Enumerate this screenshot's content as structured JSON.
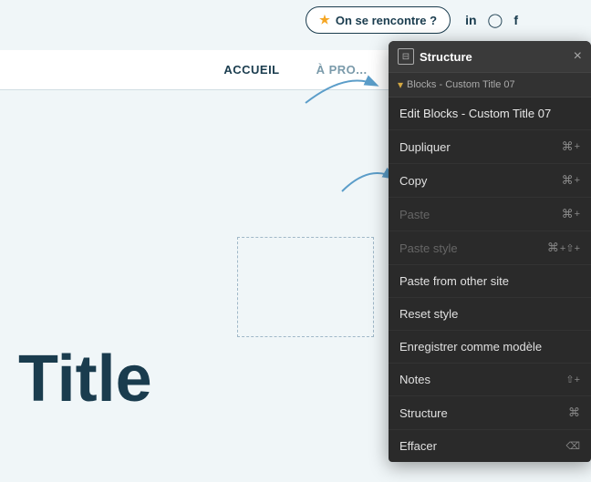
{
  "site": {
    "topbar": {
      "cta_label": "On se rencontre ?",
      "star": "★",
      "icons": [
        "in",
        "◯",
        "f"
      ]
    },
    "nav": {
      "items": [
        "ACCUEIL",
        "À PRO..."
      ]
    },
    "title": "Title"
  },
  "panel": {
    "title": "Structure",
    "close": "×",
    "icon": "⊟",
    "breadcrumb": "Blocks - Custom Title 07",
    "menu_items": [
      {
        "label": "Edit Blocks - Custom Title 07",
        "shortcut": "",
        "disabled": false
      },
      {
        "label": "Dupliquer",
        "shortcut": "⌘+",
        "disabled": false
      },
      {
        "label": "Copy",
        "shortcut": "⌘+",
        "disabled": false
      },
      {
        "label": "Paste",
        "shortcut": "⌘+",
        "disabled": true
      },
      {
        "label": "Paste style",
        "shortcut": "⌘+⇧+",
        "disabled": true
      },
      {
        "label": "Paste from other site",
        "shortcut": "",
        "disabled": false
      },
      {
        "label": "Reset style",
        "shortcut": "",
        "disabled": false
      },
      {
        "label": "Enregistrer comme modèle",
        "shortcut": "",
        "disabled": false
      },
      {
        "label": "Notes",
        "shortcut": "⇧+",
        "disabled": false
      },
      {
        "label": "Structure",
        "shortcut": "⌘",
        "disabled": false
      },
      {
        "label": "Effacer",
        "shortcut": "⌫",
        "disabled": false
      }
    ]
  }
}
